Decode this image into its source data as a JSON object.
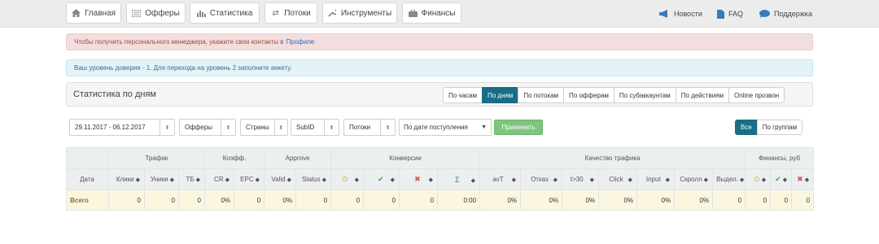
{
  "nav": {
    "items": [
      {
        "label": "Главная",
        "icon": "home-icon"
      },
      {
        "label": "Офферы",
        "icon": "list-icon"
      },
      {
        "label": "Статистика",
        "icon": "bar-chart-icon"
      },
      {
        "label": "Потоки",
        "icon": "shuffle-icon"
      },
      {
        "label": "Инструменты",
        "icon": "wrench-icon"
      },
      {
        "label": "Финансы",
        "icon": "briefcase-icon"
      }
    ],
    "right": [
      {
        "label": "Новости",
        "icon": "megaphone-icon"
      },
      {
        "label": "FAQ",
        "icon": "document-icon"
      },
      {
        "label": "Поддержка",
        "icon": "chat-icon"
      }
    ]
  },
  "alerts": {
    "danger_text": "Чтобы получить персонального менеджера, укажите свои контакты в",
    "danger_link": "Профиле",
    "info_text": "Ваш уровень доверия - 1. Для перехода на уровень 2 заполните анкету."
  },
  "panel": {
    "title": "Статистика по дням",
    "views": [
      "По часам",
      "По дням",
      "По потокам",
      "По офферам",
      "По субаккаунтам",
      "По действиям",
      "Online прозвон"
    ],
    "active_view": "По дням"
  },
  "filters": {
    "date_range": "29.11.2017 - 06.12.2017",
    "offers": "Офферы",
    "countries": "Страны",
    "subid": "SubID",
    "streams": "Потоки",
    "date_mode": "По дате поступления",
    "apply": "Применить",
    "grouping": [
      "Все",
      "По группам"
    ]
  },
  "table": {
    "groups": [
      "Трафик",
      "Коэфф.",
      "Approve",
      "Конверсии",
      "Качество трафика",
      "Финансы, руб"
    ],
    "date_header": "Дата",
    "columns": [
      "Клики",
      "Уники",
      "ТБ",
      "CR",
      "EPC",
      "Valid",
      "Status",
      "",
      "",
      "",
      "",
      "avT",
      "Отказ",
      "t>30",
      "Click",
      "Input",
      "Скролл",
      "Выдел.",
      "",
      "",
      ""
    ],
    "total": {
      "label": "Всего",
      "values": [
        "0",
        "0",
        "0",
        "0%",
        "0",
        "0%",
        "0",
        "0",
        "0",
        "0",
        "0:00",
        "0%",
        "0%",
        "0%",
        "0%",
        "0%",
        "0%",
        "0",
        "0",
        "0",
        "0"
      ]
    }
  },
  "colors": {
    "accent": "#1a6d86",
    "apply": "#7fc47f",
    "total_row": "#fbf6df"
  }
}
